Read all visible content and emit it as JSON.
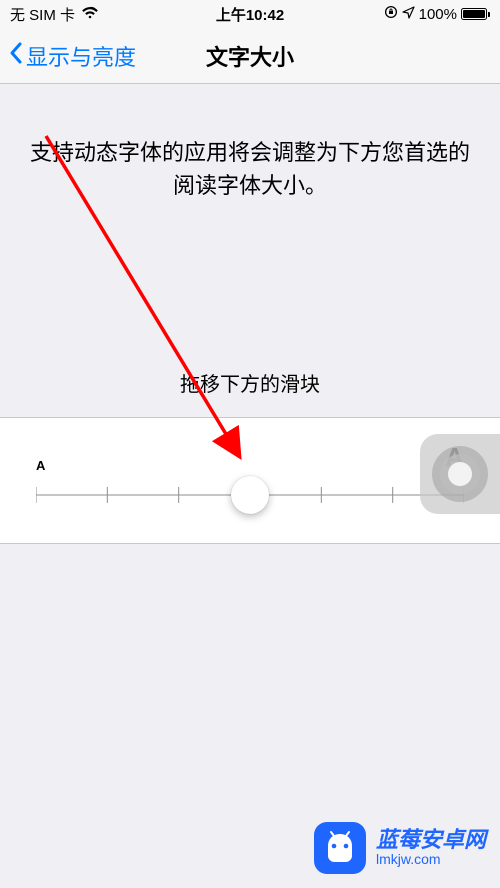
{
  "status_bar": {
    "carrier": "无 SIM 卡",
    "time": "上午10:42",
    "battery_pct": "100%"
  },
  "nav": {
    "back_label": "显示与亮度",
    "title": "文字大小"
  },
  "body": {
    "description": "支持动态字体的应用将会调整为下方您首选的阅读字体大小。",
    "slider_hint": "拖移下方的滑块",
    "slider_min_label": "A",
    "slider_max_label": "A",
    "slider_steps": 7,
    "slider_value_index": 3
  },
  "annotation": {
    "arrow_color": "#ff0000"
  },
  "watermark": {
    "title": "蓝莓安卓网",
    "url": "lmkjw.com"
  }
}
